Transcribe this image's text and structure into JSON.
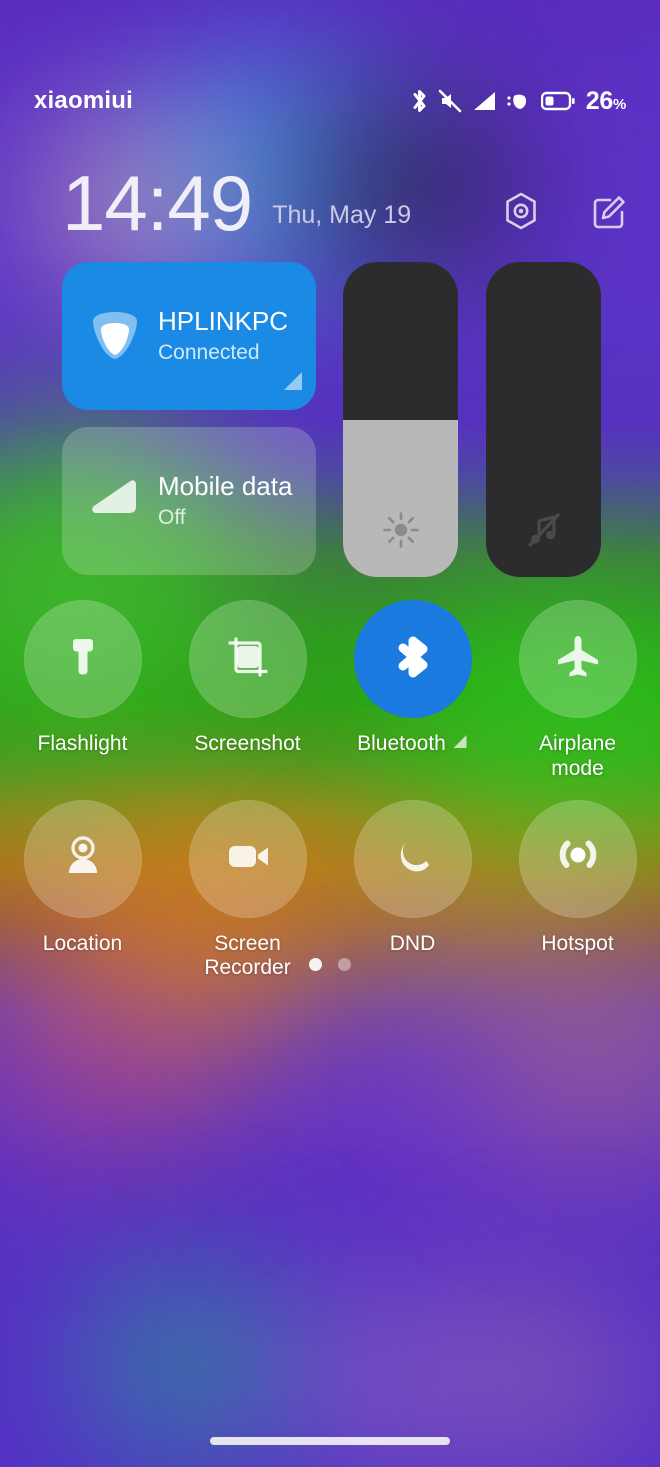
{
  "status_bar": {
    "carrier": "xiaomiui",
    "battery_percent": "26",
    "percent_symbol": "%",
    "icons": [
      "bluetooth-icon",
      "mute-icon",
      "signal-bars-icon",
      "signal-strength-icon",
      "battery-icon"
    ]
  },
  "header": {
    "time": "14:49",
    "date": "Thu, May 19",
    "actions": [
      "settings-hexagon-icon",
      "edit-icon"
    ]
  },
  "connectivity_cards": [
    {
      "id": "wifi",
      "title": "HPLINKPC",
      "subtitle": "Connected",
      "icon": "wifi-icon",
      "active": true,
      "accent": "#1a8ae5",
      "has_expand_arrow": true
    },
    {
      "id": "mobile-data",
      "title": "Mobile data",
      "subtitle": "Off",
      "icon": "mobile-data-icon",
      "active": false,
      "accent": "rgba(255,255,255,0.20)",
      "has_expand_arrow": false
    }
  ],
  "sliders": [
    {
      "id": "brightness",
      "icon": "brightness-sun-icon",
      "value_percent": 50,
      "track_color": "#2c2c2e",
      "fill_color": "#b8b8b8"
    },
    {
      "id": "volume",
      "icon": "volume-muted-note-icon",
      "value_percent": 0,
      "track_color": "#2c2c2e",
      "fill_color": "#b8b8b8"
    }
  ],
  "toggles": [
    {
      "label": "Flashlight",
      "icon": "flashlight-icon",
      "active": false,
      "arrow": false
    },
    {
      "label": "Screenshot",
      "icon": "screenshot-icon",
      "active": false,
      "arrow": false
    },
    {
      "label": "Bluetooth",
      "icon": "bluetooth-icon",
      "active": true,
      "arrow": true
    },
    {
      "label": "Airplane mode",
      "icon": "airplane-icon",
      "active": false,
      "arrow": false
    },
    {
      "label": "Location",
      "icon": "location-person-icon",
      "active": false,
      "arrow": false
    },
    {
      "label": "Screen Recorder",
      "icon": "screen-recorder-icon",
      "active": false,
      "arrow": false
    },
    {
      "label": "DND",
      "icon": "moon-icon",
      "active": false,
      "arrow": false
    },
    {
      "label": "Hotspot",
      "icon": "hotspot-icon",
      "active": false,
      "arrow": false
    }
  ],
  "pagination": {
    "total": 2,
    "active_index": 0
  },
  "colors": {
    "accent_blue": "#1a8ae5",
    "toggle_on_blue": "#1a7ae0",
    "slider_track": "#2c2c2e",
    "slider_fill": "#b8b8b8",
    "text_primary": "#ffffff",
    "background_purple": "#5b31c4"
  }
}
